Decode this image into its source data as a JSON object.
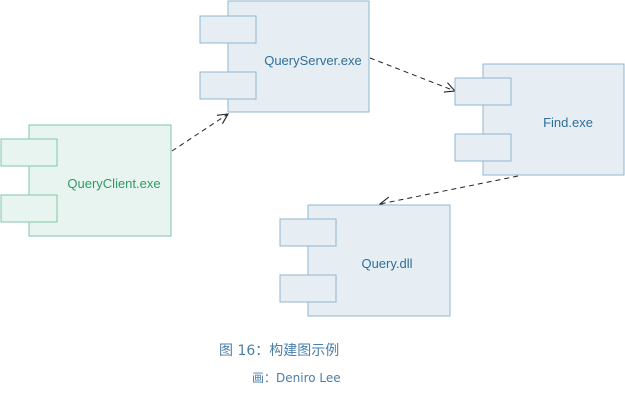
{
  "diagram": {
    "components": [
      {
        "id": "queryserver",
        "label": "QueryServer.exe",
        "color": "blue"
      },
      {
        "id": "find",
        "label": "Find.exe",
        "color": "blue"
      },
      {
        "id": "queryclient",
        "label": "QueryClient.exe",
        "color": "green"
      },
      {
        "id": "querydll",
        "label": "Query.dll",
        "color": "blue"
      }
    ],
    "dependencies": [
      {
        "from": "queryclient",
        "to": "queryserver",
        "style": "dashed"
      },
      {
        "from": "queryserver",
        "to": "find",
        "style": "dashed"
      },
      {
        "from": "find",
        "to": "querydll",
        "style": "dashed"
      }
    ]
  },
  "caption": {
    "title": "图 16：构建图示例",
    "credit": "画：Deniro Lee"
  },
  "colors": {
    "blue_fill": "#e7eef3",
    "blue_stroke": "#8fb7d3",
    "blue_text": "#2f6f99",
    "green_fill": "#e8f4ef",
    "green_stroke": "#7fc7a4",
    "green_text": "#2f9a6a",
    "arrow": "#222222",
    "caption_text": "#4a7ea8"
  }
}
